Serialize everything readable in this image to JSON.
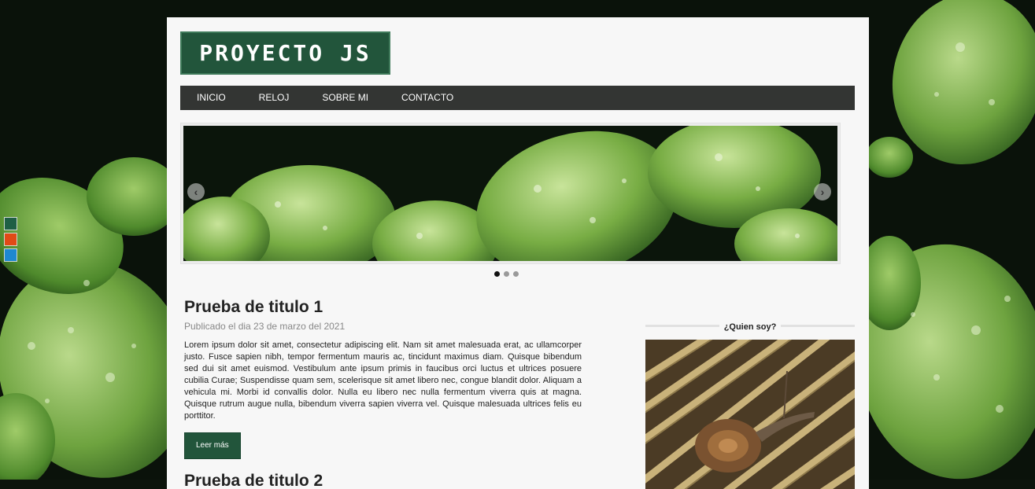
{
  "logo": {
    "text": "PROYECTO JS"
  },
  "nav": {
    "items": [
      "INICIO",
      "RELOJ",
      "SOBRE MI",
      "CONTACTO"
    ]
  },
  "slider": {
    "prev_icon": "chevron-left-icon",
    "next_icon": "chevron-right-icon",
    "slide_count": 3,
    "active_slide": 1
  },
  "article": {
    "title": "Prueba de titulo 1",
    "meta": "Publicado el dia 23 de marzo del 2021",
    "body": "Lorem ipsum dolor sit amet, consectetur adipiscing elit. Nam sit amet malesuada erat, ac ullamcorper justo. Fusce sapien nibh, tempor fermentum mauris ac, tincidunt maximus diam. Quisque bibendum sed dui sit amet euismod. Vestibulum ante ipsum primis in faucibus orci luctus et ultrices posuere cubilia Curae; Suspendisse quam sem, scelerisque sit amet libero nec, congue blandit dolor. Aliquam a vehicula mi. Morbi id convallis dolor. Nulla eu libero nec nulla fermentum viverra quis at magna. Quisque rutrum augue nulla, bibendum viverra sapien viverra vel. Quisque malesuada ultrices felis eu porttitor.",
    "read_more": "Leer más"
  },
  "article2": {
    "title": "Prueba de titulo 2"
  },
  "sidebar": {
    "widget_title": "¿Quien soy?"
  },
  "theme": {
    "swatches": [
      "#1f5f45",
      "#e04a16",
      "#1e88d0"
    ]
  }
}
